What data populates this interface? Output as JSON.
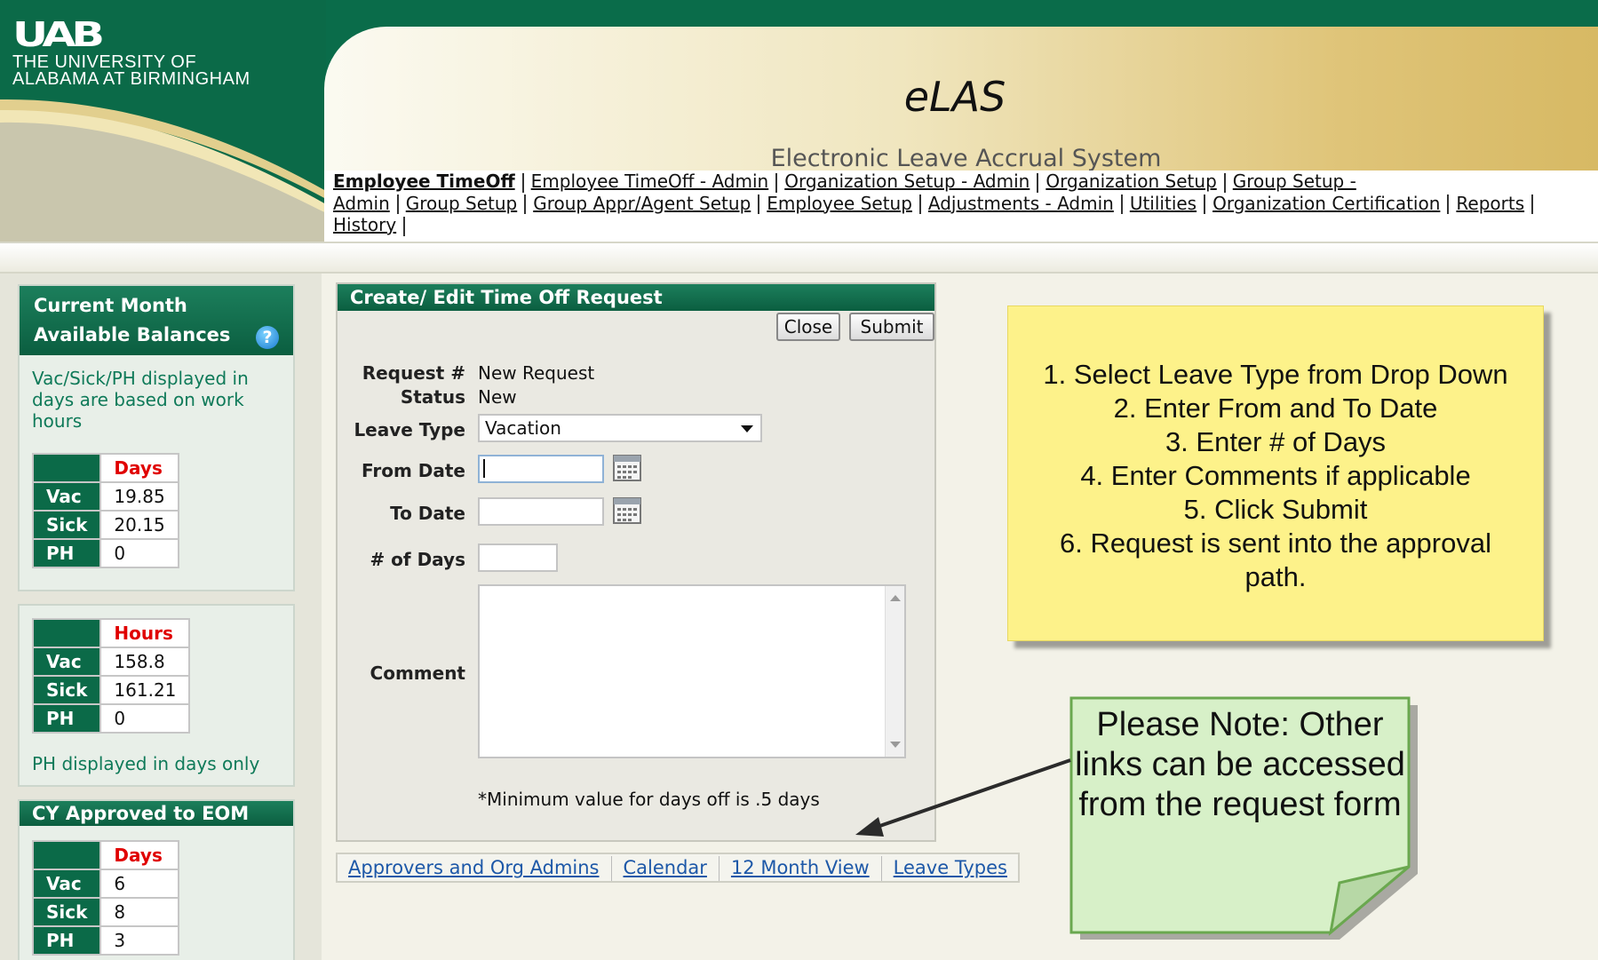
{
  "header": {
    "logo_mark": "UAB",
    "university_line1": "THE UNIVERSITY OF",
    "university_line2": "ALABAMA AT BIRMINGHAM",
    "app_title": "eLAS",
    "app_subtitle": "Electronic Leave Accrual System"
  },
  "nav": {
    "items": [
      "Employee TimeOff",
      "Employee TimeOff - Admin",
      "Organization Setup - Admin",
      "Organization Setup",
      "Group Setup -",
      "Admin",
      "Group Setup",
      "Group Appr/Agent Setup",
      "Employee Setup",
      "Adjustments - Admin",
      "Utilities",
      "Organization Certification",
      "Reports",
      "History"
    ],
    "active": "Employee TimeOff"
  },
  "sidebar": {
    "balances_panel": {
      "title_line1": "Current Month",
      "title_line2": "Available Balances",
      "help_icon": "?",
      "note": "Vac/Sick/PH displayed in days are based on work hours",
      "days_table": {
        "header": "Days",
        "rows": [
          {
            "label": "Vac",
            "value": "19.85"
          },
          {
            "label": "Sick",
            "value": "20.15"
          },
          {
            "label": "PH",
            "value": "0"
          }
        ]
      }
    },
    "hours_panel": {
      "hours_table": {
        "header": "Hours",
        "rows": [
          {
            "label": "Vac",
            "value": "158.8"
          },
          {
            "label": "Sick",
            "value": "161.21"
          },
          {
            "label": "PH",
            "value": "0"
          }
        ]
      },
      "note": "PH displayed in days only"
    },
    "approved_panel": {
      "title": "CY Approved to EOM",
      "days_table": {
        "header": "Days",
        "rows": [
          {
            "label": "Vac",
            "value": "6"
          },
          {
            "label": "Sick",
            "value": "8"
          },
          {
            "label": "PH",
            "value": "3"
          }
        ]
      }
    }
  },
  "form": {
    "title": "Create/ Edit Time Off Request",
    "close_label": "Close",
    "submit_label": "Submit",
    "request_label": "Request #",
    "request_value": "New Request",
    "status_label": "Status",
    "status_value": "New",
    "leave_type_label": "Leave Type",
    "leave_type_value": "Vacation",
    "from_date_label": "From Date",
    "from_date_value": "",
    "to_date_label": "To Date",
    "to_date_value": "",
    "days_label": "# of Days",
    "days_value": "",
    "comment_label": "Comment",
    "comment_value": "",
    "min_note": "*Minimum value for days off is .5 days"
  },
  "form_links": [
    "Approvers and Org Admins",
    "Calendar",
    "12 Month View",
    "Leave Types"
  ],
  "instructions": [
    "1. Select Leave Type from Drop Down",
    "2. Enter From and To Date",
    "3. Enter # of Days",
    "4. Enter Comments if applicable",
    "5. Click Submit",
    "6. Request is sent into the approval path."
  ],
  "note_callout": "Please Note: Other links can be accessed from the request form",
  "colors": {
    "uab_green": "#0b6a48",
    "gold": "#d7b964",
    "sticky_yellow": "#fdf28a",
    "sticky_green": "#d7f0c8",
    "link_blue": "#1d58a8",
    "days_header_red": "#e00000"
  },
  "icons": [
    "help-icon",
    "calendar-icon",
    "dropdown-caret-icon",
    "arrow-icon"
  ]
}
